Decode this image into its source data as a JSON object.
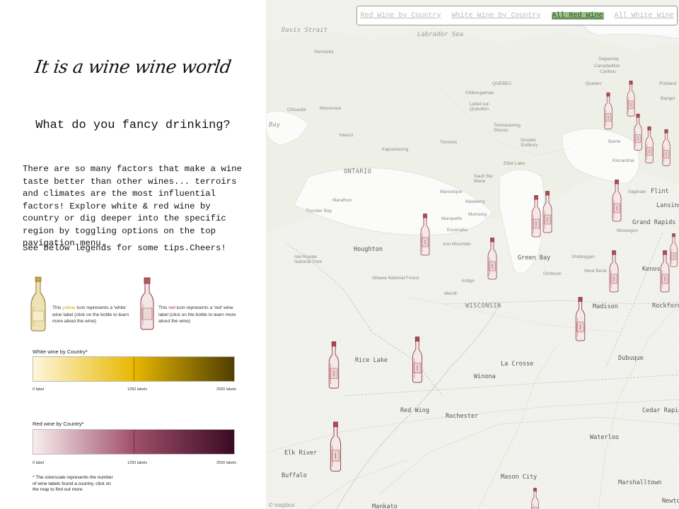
{
  "intro_panel": {
    "title": "It is a wine wine world",
    "subtitle": "What do you fancy drinking?",
    "description": "There are so many factors that make a wine taste better than other wines... terroirs and climates are the most influential factors! Explore white & red wine by country or dig deeper into the specific region by toggling options on the top navigation menu.",
    "tips": "See below legends for some tips.Cheers!"
  },
  "legend": {
    "white_icon": {
      "prefix": "This ",
      "highlight": "yellow",
      "suffix": " icon represents a 'white' wine label (click on the bottle to learn more about the wine)"
    },
    "red_icon": {
      "prefix": "This ",
      "highlight": "red",
      "suffix": " icon represents a 'red' wine label (click on the bottle to learn more about the wine)"
    },
    "white_scale": {
      "title": "White wine by Country*",
      "ticks": [
        "0 label",
        "1250 labels",
        "2500 labels"
      ],
      "colors": [
        "#fdf6dc",
        "#e8b800",
        "#4f3e00"
      ]
    },
    "red_scale": {
      "title": "Red wine by Country*",
      "ticks": [
        "0 label",
        "1250 labels",
        "2500 labels"
      ],
      "colors": [
        "#f8eef0",
        "#a0506a",
        "#3a0a24"
      ]
    },
    "footnote": "* The colorscale represents the number of wine labels found a country, click on the map to find out more"
  },
  "nav": {
    "items": [
      {
        "label": "Red Wine by Country",
        "active": false
      },
      {
        "label": "White Wine by Country",
        "active": false
      },
      {
        "label": "All Red Wine",
        "active": true
      },
      {
        "label": "All White Wine",
        "active": false
      }
    ]
  },
  "map": {
    "labels": {
      "davis_strait": "Davis Strait",
      "labrador_sea": "Labrador Sea",
      "bay": "Bay",
      "ontario": "ONTARIO",
      "quebec": "QUEBEC",
      "chibougamau": "Chibougamau",
      "lebel": "Lebel-sur-Quévillon",
      "temiskaming": "Temiskaming Shores",
      "greater_sudbury": "Greater Sudbury",
      "elliot_lake": "Elliot Lake",
      "sault_ste_marie": "Sault Ste. Marie",
      "marathon": "Marathon",
      "thunder_bay": "Thunder Bay",
      "hearst": "Hearst",
      "kapuskasing": "Kapuskasing",
      "timmins": "Timmins",
      "moosonee": "Moosonee",
      "chisasibi": "Chisasibi",
      "nemaska": "Nemaska",
      "quebec_city": "Quebec",
      "saguenay": "Saguenay",
      "campbellton": "Campbellton",
      "caribou": "Caribou",
      "bangor": "Bangor",
      "portland": "Portland",
      "barrie": "Barrie",
      "kincardine": "Kincardine",
      "flint": "Flint",
      "lansing": "Lansing",
      "grand_rapids": "Grand Rapids",
      "muskegon": "Muskegon",
      "saginaw": "Saginaw",
      "houghton": "Houghton",
      "iron_mountain": "Iron Mountain",
      "escanaba": "Escanaba",
      "marquette": "Marquette",
      "munising": "Munising",
      "newberry": "Newberry",
      "manistique": "Manistique",
      "isle_royale": "Isle Royale National Park",
      "ottawa_nf": "Ottawa National Forest",
      "green_bay": "Green Bay",
      "sheboygan": "Sheboygan",
      "oshkosh": "Oshkosh",
      "west_bend": "West Bend",
      "kenosha": "Kenosha",
      "antigo": "Antigo",
      "merrill": "Merrill",
      "wisconsin": "WISCONSIN",
      "madison": "Madison",
      "rockford": "Rockford",
      "rice_lake": "Rice Lake",
      "la_crosse": "La Crosse",
      "winona": "Winona",
      "dubuque": "Dubuque",
      "red_wing": "Red Wing",
      "rochester": "Rochester",
      "cedar_rapids": "Cedar Rapid",
      "waterloo": "Waterloo",
      "elk_river": "Elk River",
      "buffalo": "Buffalo",
      "mason_city": "Mason City",
      "marshalltown": "Marshalltown",
      "newton": "Newto",
      "mankato": "Mankato",
      "mapbox": "© mapbox"
    }
  }
}
